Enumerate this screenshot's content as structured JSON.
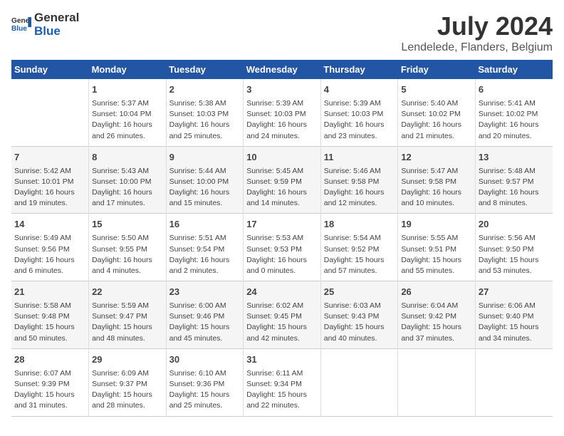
{
  "header": {
    "logo_general": "General",
    "logo_blue": "Blue",
    "title": "July 2024",
    "subtitle": "Lendelede, Flanders, Belgium"
  },
  "days_of_week": [
    "Sunday",
    "Monday",
    "Tuesday",
    "Wednesday",
    "Thursday",
    "Friday",
    "Saturday"
  ],
  "weeks": [
    [
      {
        "day": "",
        "lines": []
      },
      {
        "day": "1",
        "lines": [
          "Sunrise: 5:37 AM",
          "Sunset: 10:04 PM",
          "Daylight: 16 hours",
          "and 26 minutes."
        ]
      },
      {
        "day": "2",
        "lines": [
          "Sunrise: 5:38 AM",
          "Sunset: 10:03 PM",
          "Daylight: 16 hours",
          "and 25 minutes."
        ]
      },
      {
        "day": "3",
        "lines": [
          "Sunrise: 5:39 AM",
          "Sunset: 10:03 PM",
          "Daylight: 16 hours",
          "and 24 minutes."
        ]
      },
      {
        "day": "4",
        "lines": [
          "Sunrise: 5:39 AM",
          "Sunset: 10:03 PM",
          "Daylight: 16 hours",
          "and 23 minutes."
        ]
      },
      {
        "day": "5",
        "lines": [
          "Sunrise: 5:40 AM",
          "Sunset: 10:02 PM",
          "Daylight: 16 hours",
          "and 21 minutes."
        ]
      },
      {
        "day": "6",
        "lines": [
          "Sunrise: 5:41 AM",
          "Sunset: 10:02 PM",
          "Daylight: 16 hours",
          "and 20 minutes."
        ]
      }
    ],
    [
      {
        "day": "7",
        "lines": [
          "Sunrise: 5:42 AM",
          "Sunset: 10:01 PM",
          "Daylight: 16 hours",
          "and 19 minutes."
        ]
      },
      {
        "day": "8",
        "lines": [
          "Sunrise: 5:43 AM",
          "Sunset: 10:00 PM",
          "Daylight: 16 hours",
          "and 17 minutes."
        ]
      },
      {
        "day": "9",
        "lines": [
          "Sunrise: 5:44 AM",
          "Sunset: 10:00 PM",
          "Daylight: 16 hours",
          "and 15 minutes."
        ]
      },
      {
        "day": "10",
        "lines": [
          "Sunrise: 5:45 AM",
          "Sunset: 9:59 PM",
          "Daylight: 16 hours",
          "and 14 minutes."
        ]
      },
      {
        "day": "11",
        "lines": [
          "Sunrise: 5:46 AM",
          "Sunset: 9:58 PM",
          "Daylight: 16 hours",
          "and 12 minutes."
        ]
      },
      {
        "day": "12",
        "lines": [
          "Sunrise: 5:47 AM",
          "Sunset: 9:58 PM",
          "Daylight: 16 hours",
          "and 10 minutes."
        ]
      },
      {
        "day": "13",
        "lines": [
          "Sunrise: 5:48 AM",
          "Sunset: 9:57 PM",
          "Daylight: 16 hours",
          "and 8 minutes."
        ]
      }
    ],
    [
      {
        "day": "14",
        "lines": [
          "Sunrise: 5:49 AM",
          "Sunset: 9:56 PM",
          "Daylight: 16 hours",
          "and 6 minutes."
        ]
      },
      {
        "day": "15",
        "lines": [
          "Sunrise: 5:50 AM",
          "Sunset: 9:55 PM",
          "Daylight: 16 hours",
          "and 4 minutes."
        ]
      },
      {
        "day": "16",
        "lines": [
          "Sunrise: 5:51 AM",
          "Sunset: 9:54 PM",
          "Daylight: 16 hours",
          "and 2 minutes."
        ]
      },
      {
        "day": "17",
        "lines": [
          "Sunrise: 5:53 AM",
          "Sunset: 9:53 PM",
          "Daylight: 16 hours",
          "and 0 minutes."
        ]
      },
      {
        "day": "18",
        "lines": [
          "Sunrise: 5:54 AM",
          "Sunset: 9:52 PM",
          "Daylight: 15 hours",
          "and 57 minutes."
        ]
      },
      {
        "day": "19",
        "lines": [
          "Sunrise: 5:55 AM",
          "Sunset: 9:51 PM",
          "Daylight: 15 hours",
          "and 55 minutes."
        ]
      },
      {
        "day": "20",
        "lines": [
          "Sunrise: 5:56 AM",
          "Sunset: 9:50 PM",
          "Daylight: 15 hours",
          "and 53 minutes."
        ]
      }
    ],
    [
      {
        "day": "21",
        "lines": [
          "Sunrise: 5:58 AM",
          "Sunset: 9:48 PM",
          "Daylight: 15 hours",
          "and 50 minutes."
        ]
      },
      {
        "day": "22",
        "lines": [
          "Sunrise: 5:59 AM",
          "Sunset: 9:47 PM",
          "Daylight: 15 hours",
          "and 48 minutes."
        ]
      },
      {
        "day": "23",
        "lines": [
          "Sunrise: 6:00 AM",
          "Sunset: 9:46 PM",
          "Daylight: 15 hours",
          "and 45 minutes."
        ]
      },
      {
        "day": "24",
        "lines": [
          "Sunrise: 6:02 AM",
          "Sunset: 9:45 PM",
          "Daylight: 15 hours",
          "and 42 minutes."
        ]
      },
      {
        "day": "25",
        "lines": [
          "Sunrise: 6:03 AM",
          "Sunset: 9:43 PM",
          "Daylight: 15 hours",
          "and 40 minutes."
        ]
      },
      {
        "day": "26",
        "lines": [
          "Sunrise: 6:04 AM",
          "Sunset: 9:42 PM",
          "Daylight: 15 hours",
          "and 37 minutes."
        ]
      },
      {
        "day": "27",
        "lines": [
          "Sunrise: 6:06 AM",
          "Sunset: 9:40 PM",
          "Daylight: 15 hours",
          "and 34 minutes."
        ]
      }
    ],
    [
      {
        "day": "28",
        "lines": [
          "Sunrise: 6:07 AM",
          "Sunset: 9:39 PM",
          "Daylight: 15 hours",
          "and 31 minutes."
        ]
      },
      {
        "day": "29",
        "lines": [
          "Sunrise: 6:09 AM",
          "Sunset: 9:37 PM",
          "Daylight: 15 hours",
          "and 28 minutes."
        ]
      },
      {
        "day": "30",
        "lines": [
          "Sunrise: 6:10 AM",
          "Sunset: 9:36 PM",
          "Daylight: 15 hours",
          "and 25 minutes."
        ]
      },
      {
        "day": "31",
        "lines": [
          "Sunrise: 6:11 AM",
          "Sunset: 9:34 PM",
          "Daylight: 15 hours",
          "and 22 minutes."
        ]
      },
      {
        "day": "",
        "lines": []
      },
      {
        "day": "",
        "lines": []
      },
      {
        "day": "",
        "lines": []
      }
    ]
  ]
}
